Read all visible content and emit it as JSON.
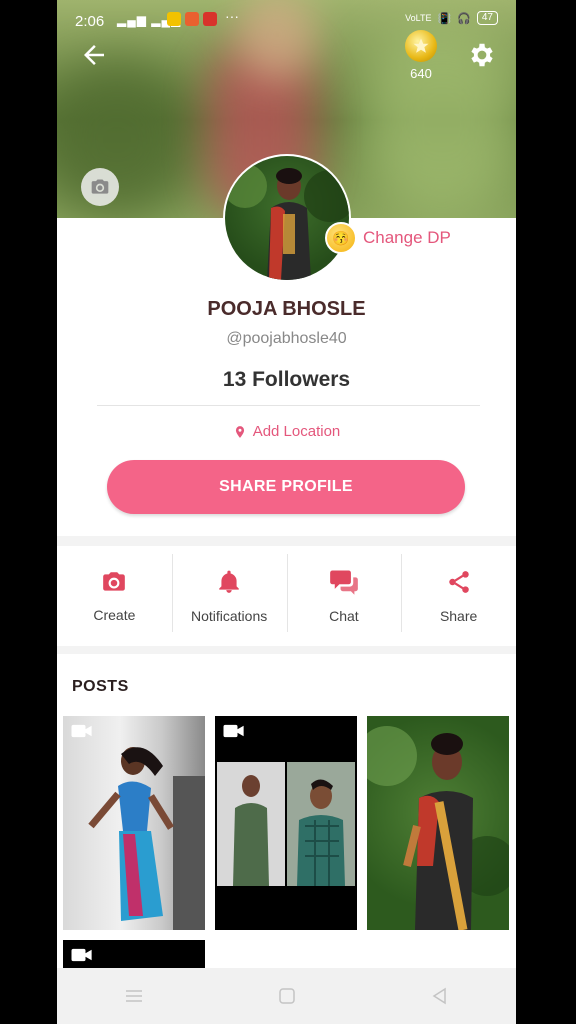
{
  "status_bar": {
    "time": "2:06",
    "signal": "ᵀᴰᴼᴵᴺ",
    "overflow": "···",
    "network": "VoLTE",
    "battery": "47"
  },
  "header": {
    "coin_count": "640",
    "icons": [
      "back-arrow-icon",
      "coin-icon",
      "gear-icon",
      "camera-icon"
    ]
  },
  "profile": {
    "change_dp_label": "Change DP",
    "name": "POOJA BHOSLE",
    "handle": "@poojabhosle40",
    "followers": "13 Followers",
    "location_label": "Add Location",
    "share_button": "SHARE PROFILE"
  },
  "actions": [
    {
      "label": "Create",
      "icon": "camera-icon"
    },
    {
      "label": "Notifications",
      "icon": "bell-icon"
    },
    {
      "label": "Chat",
      "icon": "chat-bubbles-icon"
    },
    {
      "label": "Share",
      "icon": "share-icon"
    }
  ],
  "posts": {
    "title": "POSTS",
    "items": [
      {
        "type": "video"
      },
      {
        "type": "video"
      },
      {
        "type": "image"
      },
      {
        "type": "video"
      }
    ]
  },
  "colors": {
    "accent": "#f46488",
    "accent_text": "#e4577c",
    "icon_red": "#e0475f"
  }
}
